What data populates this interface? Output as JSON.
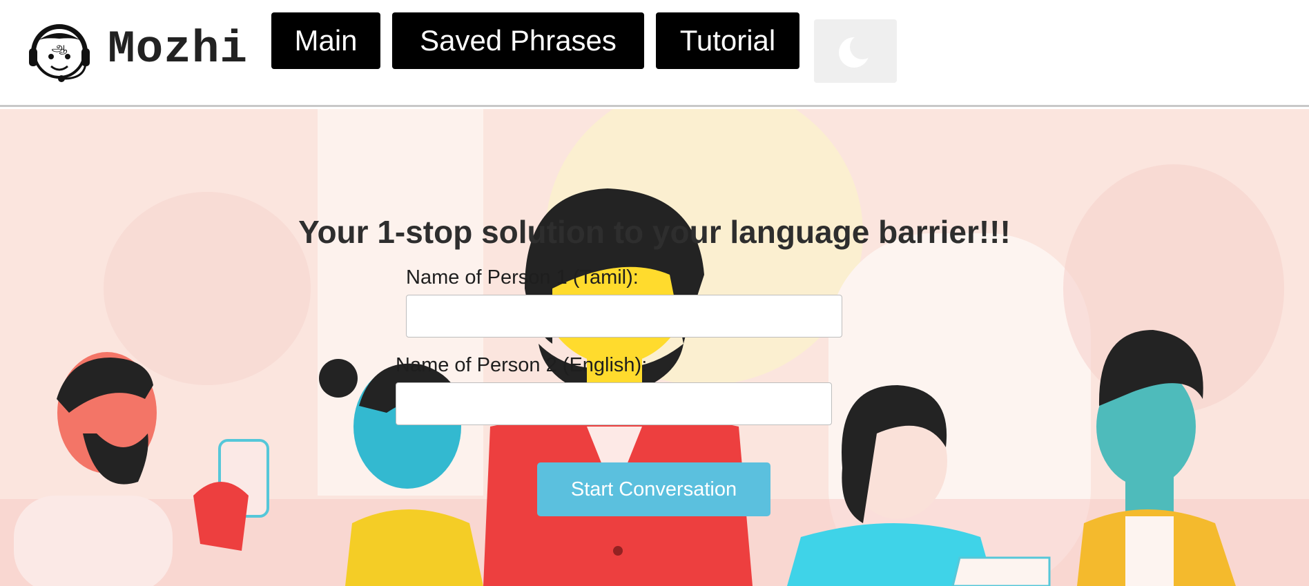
{
  "brand": {
    "name": "Mozhi",
    "logo_icon": "headset-mascot-icon"
  },
  "nav": {
    "items": [
      {
        "label": "Main"
      },
      {
        "label": "Saved Phrases"
      },
      {
        "label": "Tutorial"
      }
    ],
    "theme_toggle_icon": "crescent-moon-icon"
  },
  "hero": {
    "headline": "Your 1-stop solution to your language barrier!!!",
    "person1_label": "Name of Person 1 (Tamil):",
    "person1_value": "",
    "person2_label": "Name of Person 2 (English):",
    "person2_value": "",
    "start_button": "Start Conversation",
    "background_illustration": "group-of-people-illustration"
  },
  "colors": {
    "nav_button_bg": "#000000",
    "nav_button_text": "#ffffff",
    "start_button_bg": "#5bc0de",
    "hero_bg": "#fbe2da",
    "toggle_bg": "#efefef"
  }
}
